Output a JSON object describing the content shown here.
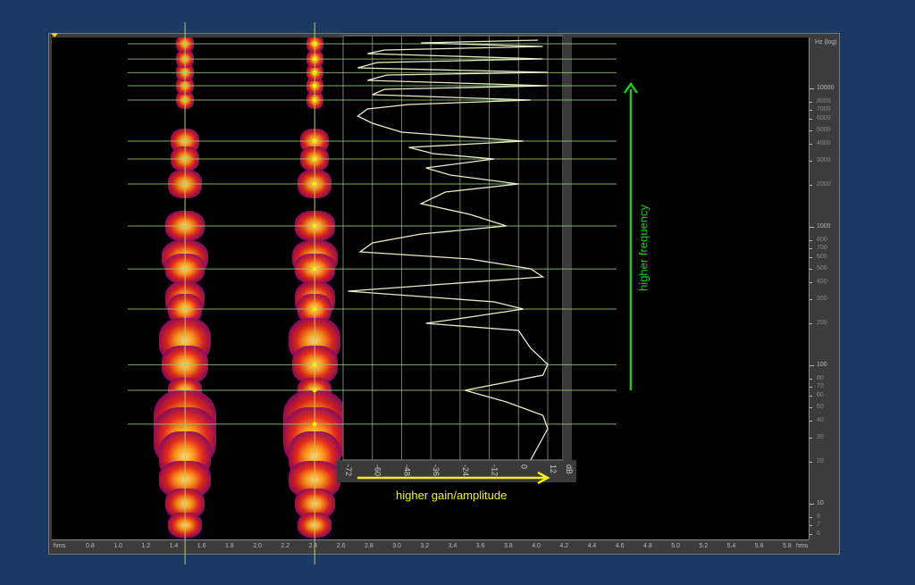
{
  "x_axis": {
    "unit_left": "hms",
    "unit_right": "hms",
    "ticks": [
      "0.8",
      "1.0",
      "1.2",
      "1.4",
      "1.6",
      "1.8",
      "2.0",
      "2.2",
      "2.4",
      "2.6",
      "2.8",
      "3.0",
      "3.2",
      "3.4",
      "3.6",
      "3.8",
      "4.0",
      "4.2",
      "4.4",
      "4.6",
      "4.8",
      "5.0",
      "5.2",
      "5.4",
      "5.6",
      "5.8"
    ]
  },
  "y_axis": {
    "unit": "Hz (log)",
    "major": [
      10000,
      1000,
      100,
      10
    ],
    "minor": [
      8000,
      7000,
      6000,
      5000,
      4000,
      3000,
      2000,
      800,
      700,
      600,
      500,
      400,
      300,
      200,
      80,
      70,
      60,
      50,
      40,
      30,
      20,
      8,
      7,
      6
    ]
  },
  "db_axis": {
    "unit": "dB",
    "ticks": [
      "-72",
      "-60",
      "-48",
      "-36",
      "-24",
      "-12",
      "0",
      "12"
    ],
    "hz_label": "Hz"
  },
  "harmonic_lines_hz": [
    21000,
    16300,
    13000,
    10460,
    8250,
    4160,
    3090,
    2040,
    1015,
    497,
    255,
    101,
    66,
    37.6
  ],
  "cursors_time": [
    1.48,
    2.41
  ],
  "annotations": {
    "x_arrow": "higher gain/amplitude",
    "y_arrow": "higher frequency"
  },
  "spectrum_curve": [
    [
      8,
      45
    ],
    [
      -40,
      48
    ],
    [
      10,
      52
    ],
    [
      -55,
      56
    ],
    [
      -62,
      60
    ],
    [
      10,
      66
    ],
    [
      -58,
      70
    ],
    [
      -66,
      76
    ],
    [
      12,
      81
    ],
    [
      -54,
      84
    ],
    [
      -62,
      90
    ],
    [
      12,
      96
    ],
    [
      -55,
      100
    ],
    [
      -60,
      106
    ],
    [
      5,
      112
    ],
    [
      -45,
      117
    ],
    [
      -62,
      122
    ],
    [
      -66,
      130
    ],
    [
      -60,
      138
    ],
    [
      -48,
      148
    ],
    [
      2,
      158
    ],
    [
      -45,
      165
    ],
    [
      -35,
      172
    ],
    [
      -10,
      178
    ],
    [
      -38,
      188
    ],
    [
      -28,
      196
    ],
    [
      0,
      206
    ],
    [
      -30,
      215
    ],
    [
      -40,
      228
    ],
    [
      -20,
      240
    ],
    [
      -5,
      253
    ],
    [
      -40,
      262
    ],
    [
      -60,
      272
    ],
    [
      -65,
      282
    ],
    [
      -20,
      290
    ],
    [
      5,
      301
    ],
    [
      10,
      310
    ],
    [
      -30,
      318
    ],
    [
      -70,
      326
    ],
    [
      -10,
      338
    ],
    [
      2,
      346
    ],
    [
      -20,
      355
    ],
    [
      -38,
      362
    ],
    [
      0,
      370
    ],
    [
      5,
      390
    ],
    [
      12,
      408
    ],
    [
      10,
      420
    ],
    [
      -22,
      437
    ],
    [
      -5,
      450
    ],
    [
      10,
      465
    ],
    [
      12,
      480
    ],
    [
      8,
      500
    ],
    [
      5,
      515
    ]
  ],
  "colors": {
    "background": "#1b3a63",
    "grid_line": "#9fc87a",
    "curve": "#e8efc8",
    "arrow_green": "#1ec81e",
    "arrow_yellow": "#f2f01a"
  }
}
